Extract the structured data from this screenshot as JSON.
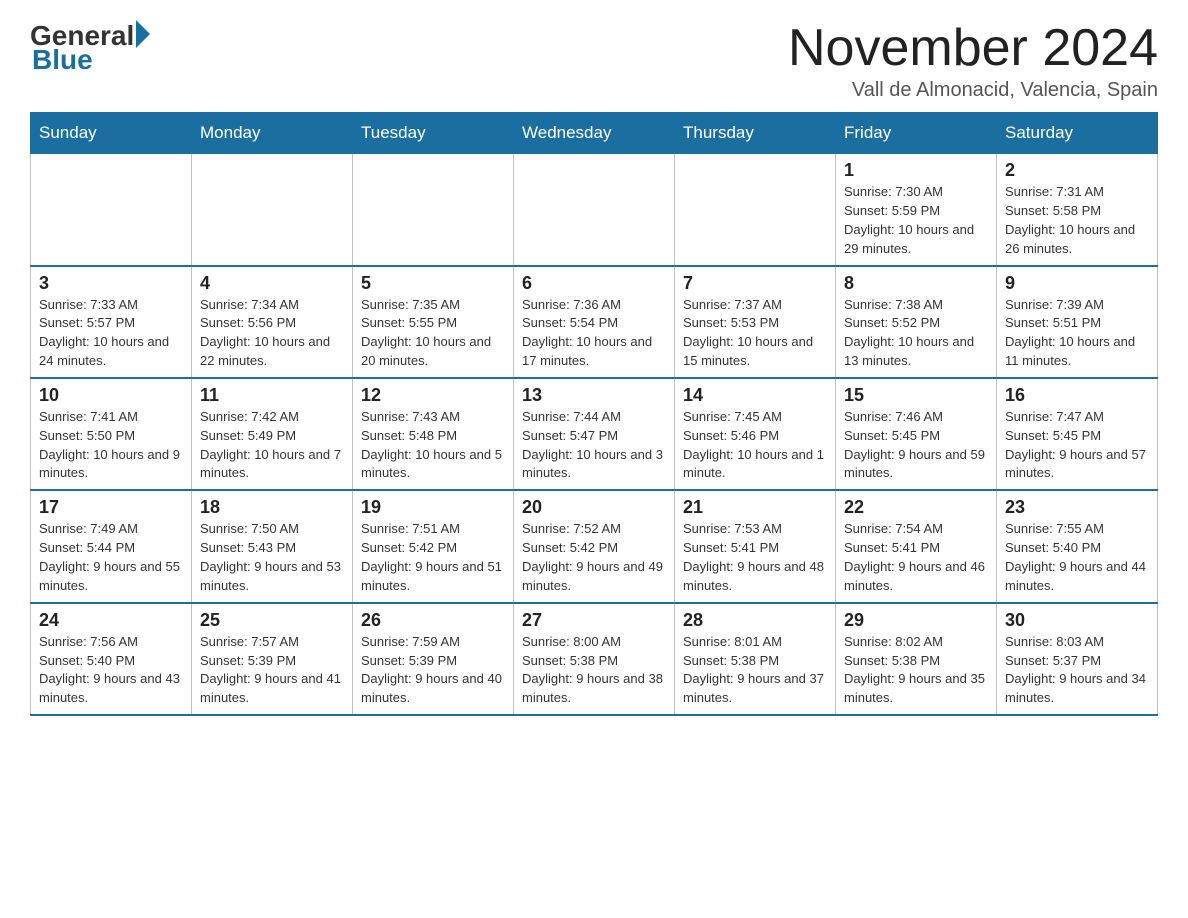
{
  "header": {
    "logo": {
      "general": "General",
      "blue": "Blue"
    },
    "title": "November 2024",
    "location": "Vall de Almonacid, Valencia, Spain"
  },
  "weekdays": [
    "Sunday",
    "Monday",
    "Tuesday",
    "Wednesday",
    "Thursday",
    "Friday",
    "Saturday"
  ],
  "weeks": [
    [
      {
        "day": "",
        "info": ""
      },
      {
        "day": "",
        "info": ""
      },
      {
        "day": "",
        "info": ""
      },
      {
        "day": "",
        "info": ""
      },
      {
        "day": "",
        "info": ""
      },
      {
        "day": "1",
        "info": "Sunrise: 7:30 AM\nSunset: 5:59 PM\nDaylight: 10 hours and 29 minutes."
      },
      {
        "day": "2",
        "info": "Sunrise: 7:31 AM\nSunset: 5:58 PM\nDaylight: 10 hours and 26 minutes."
      }
    ],
    [
      {
        "day": "3",
        "info": "Sunrise: 7:33 AM\nSunset: 5:57 PM\nDaylight: 10 hours and 24 minutes."
      },
      {
        "day": "4",
        "info": "Sunrise: 7:34 AM\nSunset: 5:56 PM\nDaylight: 10 hours and 22 minutes."
      },
      {
        "day": "5",
        "info": "Sunrise: 7:35 AM\nSunset: 5:55 PM\nDaylight: 10 hours and 20 minutes."
      },
      {
        "day": "6",
        "info": "Sunrise: 7:36 AM\nSunset: 5:54 PM\nDaylight: 10 hours and 17 minutes."
      },
      {
        "day": "7",
        "info": "Sunrise: 7:37 AM\nSunset: 5:53 PM\nDaylight: 10 hours and 15 minutes."
      },
      {
        "day": "8",
        "info": "Sunrise: 7:38 AM\nSunset: 5:52 PM\nDaylight: 10 hours and 13 minutes."
      },
      {
        "day": "9",
        "info": "Sunrise: 7:39 AM\nSunset: 5:51 PM\nDaylight: 10 hours and 11 minutes."
      }
    ],
    [
      {
        "day": "10",
        "info": "Sunrise: 7:41 AM\nSunset: 5:50 PM\nDaylight: 10 hours and 9 minutes."
      },
      {
        "day": "11",
        "info": "Sunrise: 7:42 AM\nSunset: 5:49 PM\nDaylight: 10 hours and 7 minutes."
      },
      {
        "day": "12",
        "info": "Sunrise: 7:43 AM\nSunset: 5:48 PM\nDaylight: 10 hours and 5 minutes."
      },
      {
        "day": "13",
        "info": "Sunrise: 7:44 AM\nSunset: 5:47 PM\nDaylight: 10 hours and 3 minutes."
      },
      {
        "day": "14",
        "info": "Sunrise: 7:45 AM\nSunset: 5:46 PM\nDaylight: 10 hours and 1 minute."
      },
      {
        "day": "15",
        "info": "Sunrise: 7:46 AM\nSunset: 5:45 PM\nDaylight: 9 hours and 59 minutes."
      },
      {
        "day": "16",
        "info": "Sunrise: 7:47 AM\nSunset: 5:45 PM\nDaylight: 9 hours and 57 minutes."
      }
    ],
    [
      {
        "day": "17",
        "info": "Sunrise: 7:49 AM\nSunset: 5:44 PM\nDaylight: 9 hours and 55 minutes."
      },
      {
        "day": "18",
        "info": "Sunrise: 7:50 AM\nSunset: 5:43 PM\nDaylight: 9 hours and 53 minutes."
      },
      {
        "day": "19",
        "info": "Sunrise: 7:51 AM\nSunset: 5:42 PM\nDaylight: 9 hours and 51 minutes."
      },
      {
        "day": "20",
        "info": "Sunrise: 7:52 AM\nSunset: 5:42 PM\nDaylight: 9 hours and 49 minutes."
      },
      {
        "day": "21",
        "info": "Sunrise: 7:53 AM\nSunset: 5:41 PM\nDaylight: 9 hours and 48 minutes."
      },
      {
        "day": "22",
        "info": "Sunrise: 7:54 AM\nSunset: 5:41 PM\nDaylight: 9 hours and 46 minutes."
      },
      {
        "day": "23",
        "info": "Sunrise: 7:55 AM\nSunset: 5:40 PM\nDaylight: 9 hours and 44 minutes."
      }
    ],
    [
      {
        "day": "24",
        "info": "Sunrise: 7:56 AM\nSunset: 5:40 PM\nDaylight: 9 hours and 43 minutes."
      },
      {
        "day": "25",
        "info": "Sunrise: 7:57 AM\nSunset: 5:39 PM\nDaylight: 9 hours and 41 minutes."
      },
      {
        "day": "26",
        "info": "Sunrise: 7:59 AM\nSunset: 5:39 PM\nDaylight: 9 hours and 40 minutes."
      },
      {
        "day": "27",
        "info": "Sunrise: 8:00 AM\nSunset: 5:38 PM\nDaylight: 9 hours and 38 minutes."
      },
      {
        "day": "28",
        "info": "Sunrise: 8:01 AM\nSunset: 5:38 PM\nDaylight: 9 hours and 37 minutes."
      },
      {
        "day": "29",
        "info": "Sunrise: 8:02 AM\nSunset: 5:38 PM\nDaylight: 9 hours and 35 minutes."
      },
      {
        "day": "30",
        "info": "Sunrise: 8:03 AM\nSunset: 5:37 PM\nDaylight: 9 hours and 34 minutes."
      }
    ]
  ]
}
